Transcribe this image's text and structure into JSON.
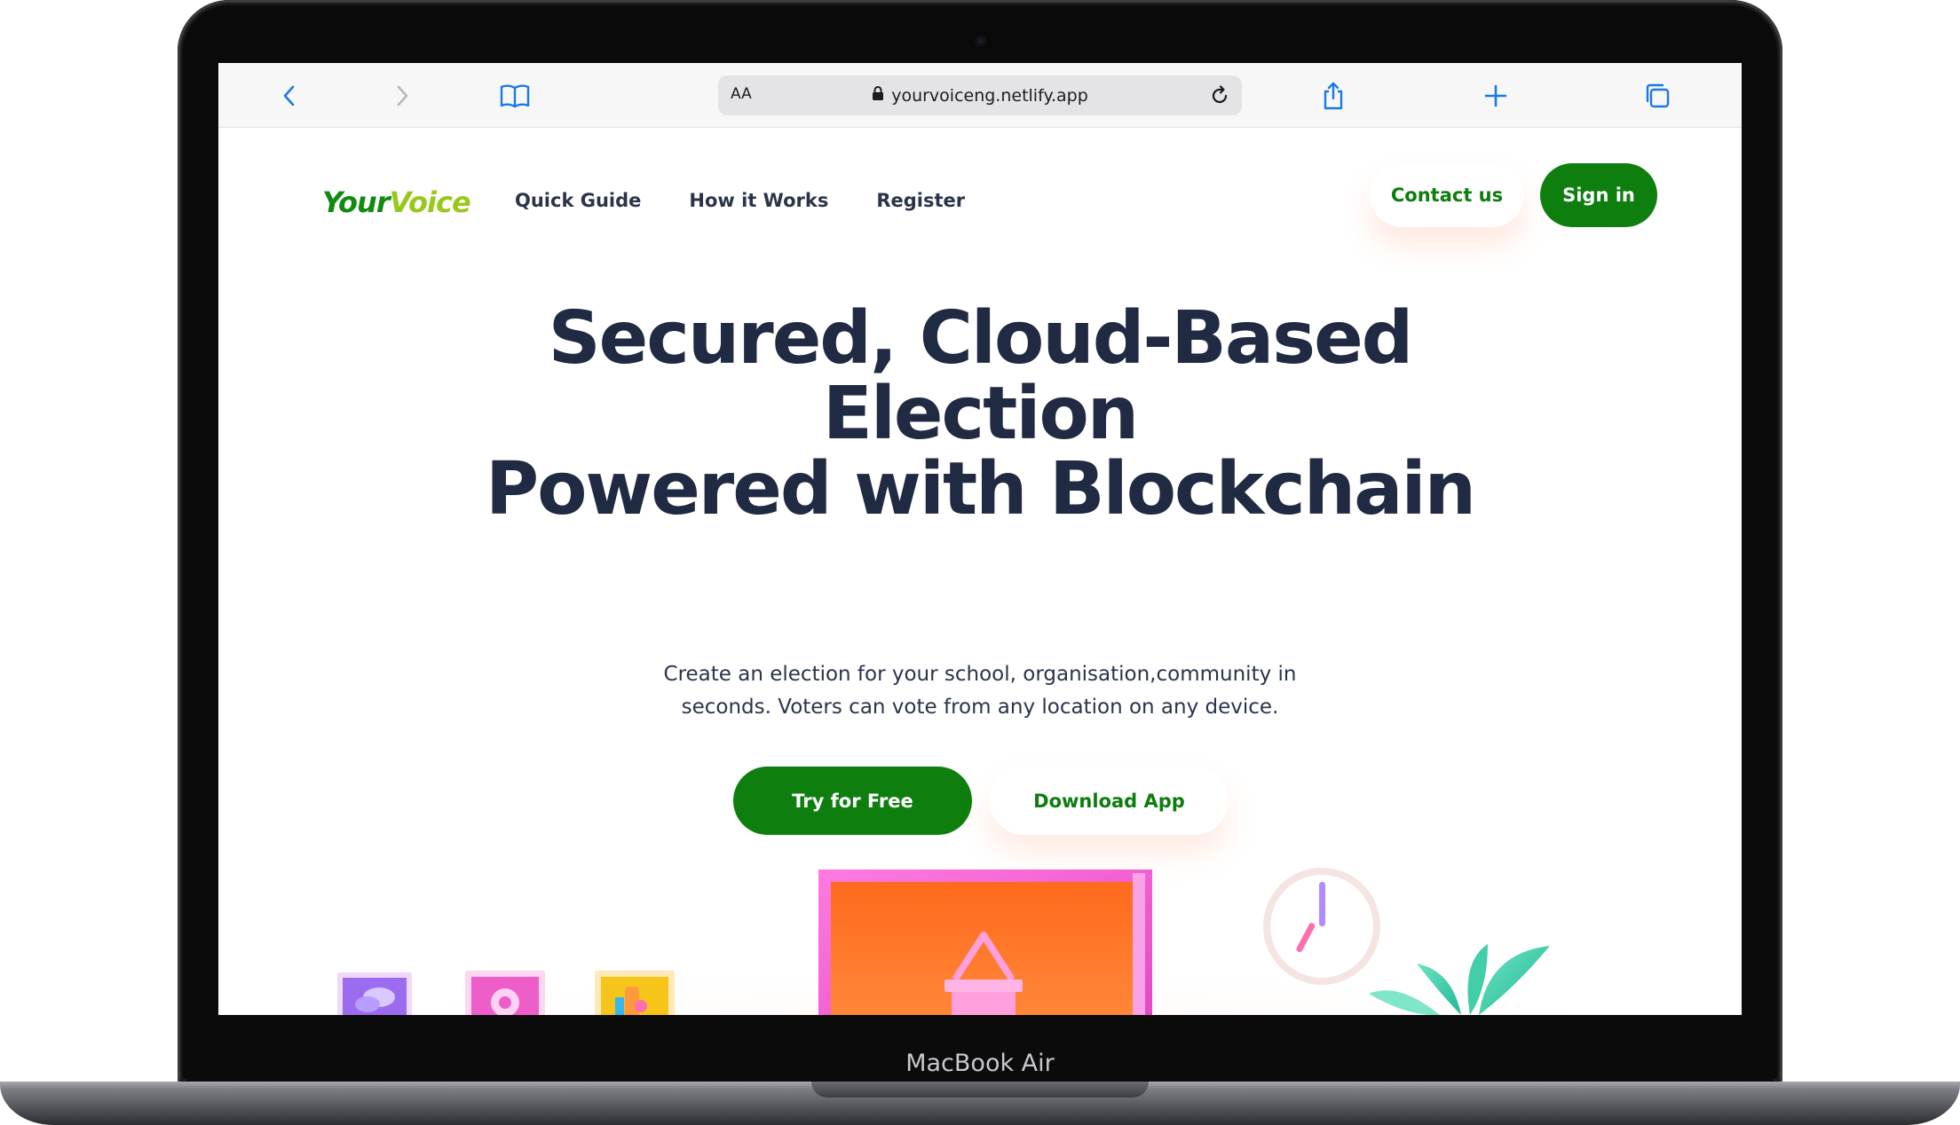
{
  "device": {
    "label": "MacBook Air"
  },
  "browser": {
    "text_size_label": "AA",
    "url": "yourvoiceng.netlify.app"
  },
  "site": {
    "logo": {
      "part1": "Your",
      "part2": "Voice"
    },
    "nav": {
      "items": [
        {
          "label": "Quick Guide"
        },
        {
          "label": "How it Works"
        },
        {
          "label": "Register"
        }
      ]
    },
    "header_actions": {
      "contact_label": "Contact us",
      "signin_label": "Sign in"
    },
    "hero": {
      "title_lines": [
        "Secured, Cloud-Based",
        "Election",
        "Powered with Blockchain"
      ],
      "subtitle_lines": [
        "Create an election for your school, organisation,community in",
        "seconds. Voters can vote from any location on any device."
      ],
      "primary_cta": "Try for Free",
      "secondary_cta": "Download App"
    }
  },
  "colors": {
    "brand_green": "#0e7e0e",
    "logo_lime": "#98c81e",
    "heading": "#202a42"
  }
}
